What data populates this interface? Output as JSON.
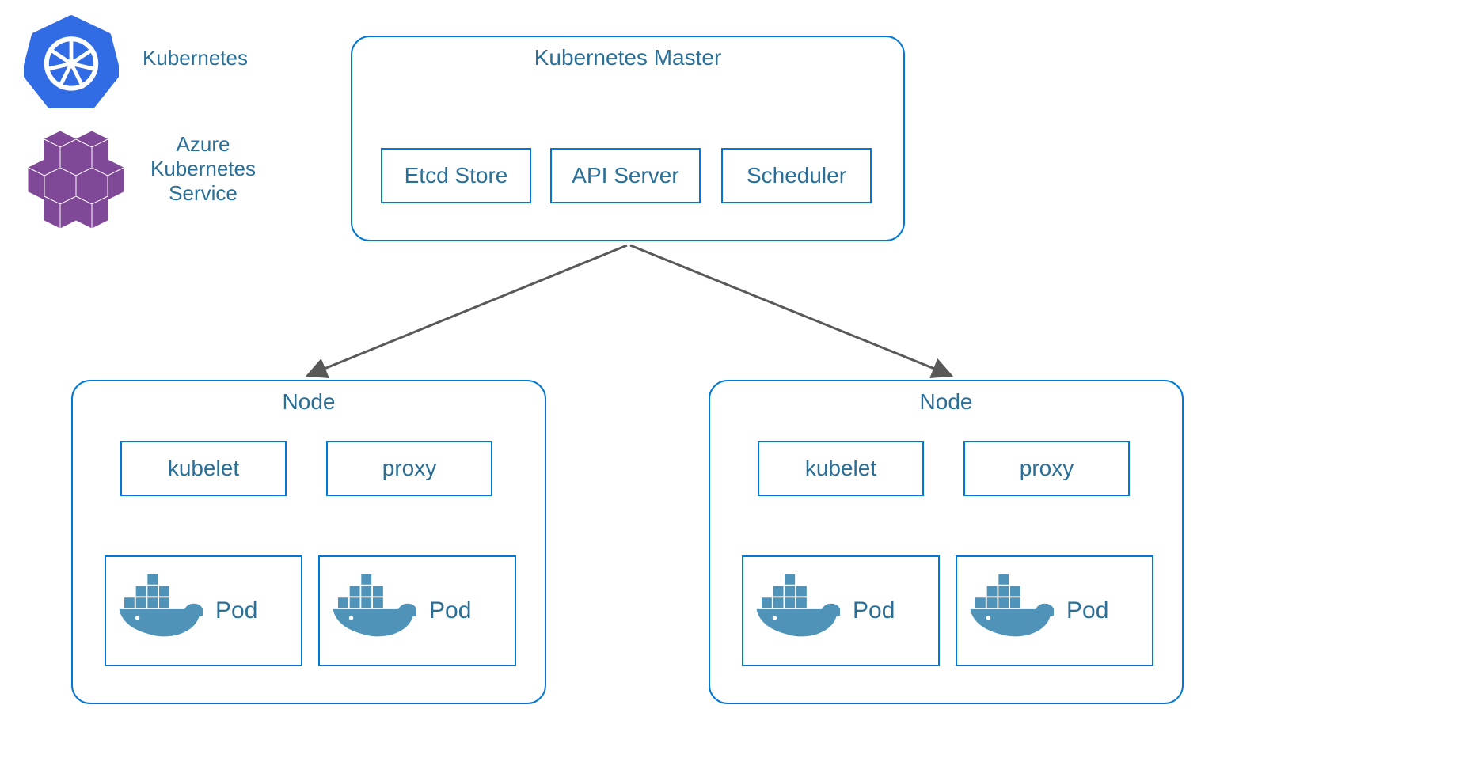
{
  "legend": {
    "kubernetes": "Kubernetes",
    "aks_line1": "Azure",
    "aks_line2": "Kubernetes",
    "aks_line3": "Service"
  },
  "master": {
    "title": "Kubernetes Master",
    "etcd": "Etcd Store",
    "api": "API Server",
    "scheduler": "Scheduler"
  },
  "node": {
    "title": "Node",
    "kubelet": "kubelet",
    "proxy": "proxy",
    "pod": "Pod"
  },
  "colors": {
    "border": "#0078d4",
    "text": "#2a6f97",
    "k8s_blue": "#326ce5",
    "aks_purple": "#804998",
    "docker": "#4f93b8",
    "arrow": "#595959"
  }
}
